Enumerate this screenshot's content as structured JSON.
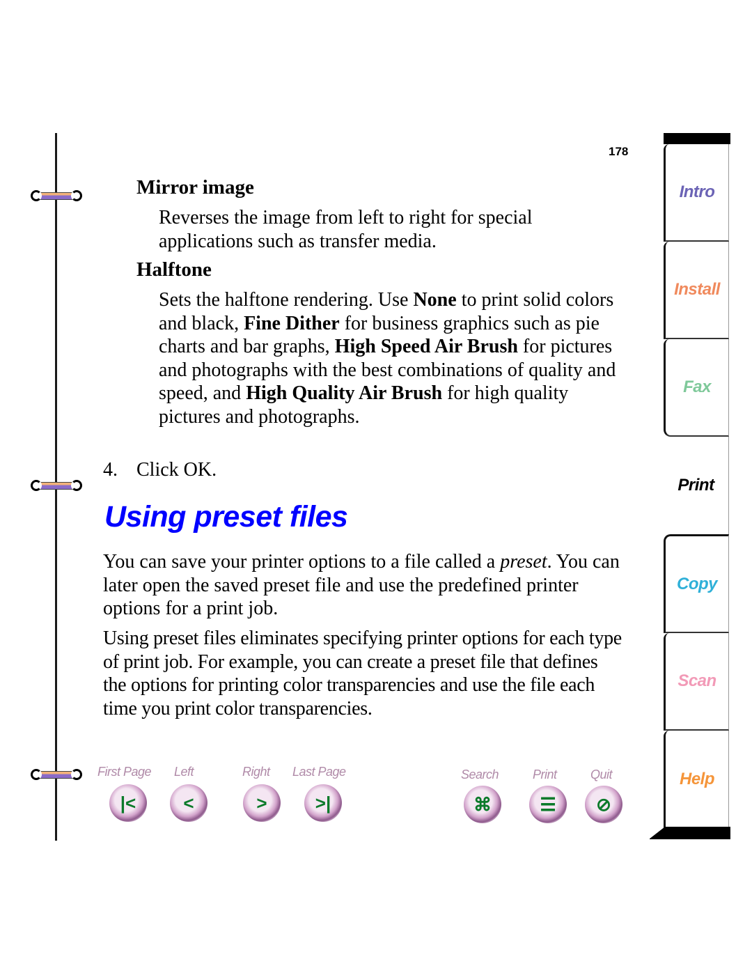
{
  "page": {
    "number": "178"
  },
  "sections": [
    {
      "heading": "Mirror image",
      "body": "Reverses the image from left to right for special applications such as transfer media."
    },
    {
      "heading": "Halftone",
      "body_parts": [
        {
          "text": "Sets the halftone rendering. Use ",
          "bold": false
        },
        {
          "text": "None",
          "bold": true
        },
        {
          "text": " to print solid colors and black, ",
          "bold": false
        },
        {
          "text": "Fine Dither",
          "bold": true
        },
        {
          "text": " for business graphics such as pie charts and bar graphs, ",
          "bold": false
        },
        {
          "text": "High Speed Air Brush",
          "bold": true
        },
        {
          "text": " for pictures and photographs with the best combinations of quality and speed, and ",
          "bold": false
        },
        {
          "text": "High Quality Air Brush",
          "bold": true
        },
        {
          "text": " for high quality pictures and photographs.",
          "bold": false
        }
      ]
    }
  ],
  "step": {
    "number": "4.",
    "text": "Click OK."
  },
  "main_section": {
    "title": "Using preset files",
    "title_color": "#0000ff",
    "para1_before": "You can save your printer options to a file called a ",
    "para1_italic": "preset",
    "para1_after": ". You can later open the saved preset file and use the predefined printer options for a print job.",
    "para2": "Using preset files eliminates specifying printer options for each type of print job. For example, you can create a preset file that defines the options for printing color transparencies and use the file each time you print color transparencies."
  },
  "navigation": [
    {
      "label": "First Page",
      "icon": "first-page-icon",
      "glyph": "|<"
    },
    {
      "label": "Left",
      "icon": "left-arrow-icon",
      "glyph": "<"
    },
    {
      "label": "Right",
      "icon": "right-arrow-icon",
      "glyph": ">"
    },
    {
      "label": "Last Page",
      "icon": "last-page-icon",
      "glyph": ">|"
    },
    {
      "label": "Search",
      "icon": "binoculars-icon",
      "glyph": "⌘"
    },
    {
      "label": "Print",
      "icon": "document-icon",
      "glyph": "☰"
    },
    {
      "label": "Quit",
      "icon": "no-entry-icon",
      "glyph": "⊘"
    }
  ],
  "tabs": [
    {
      "label": "Intro",
      "color": "#6b63b5",
      "active": false
    },
    {
      "label": "Install",
      "color": "#f08a5d",
      "active": false
    },
    {
      "label": "Fax",
      "color": "#7fc99a",
      "active": false
    },
    {
      "label": "Print",
      "color": "#000000",
      "active": true
    },
    {
      "label": "Copy",
      "color": "#2fb0d8",
      "active": false
    },
    {
      "label": "Scan",
      "color": "#f29ab7",
      "active": false
    },
    {
      "label": "Help",
      "color": "#f5953a",
      "active": false
    }
  ],
  "colors": {
    "nav_label": "#b08aa8",
    "nav_glyph": "#0b7a2a"
  }
}
